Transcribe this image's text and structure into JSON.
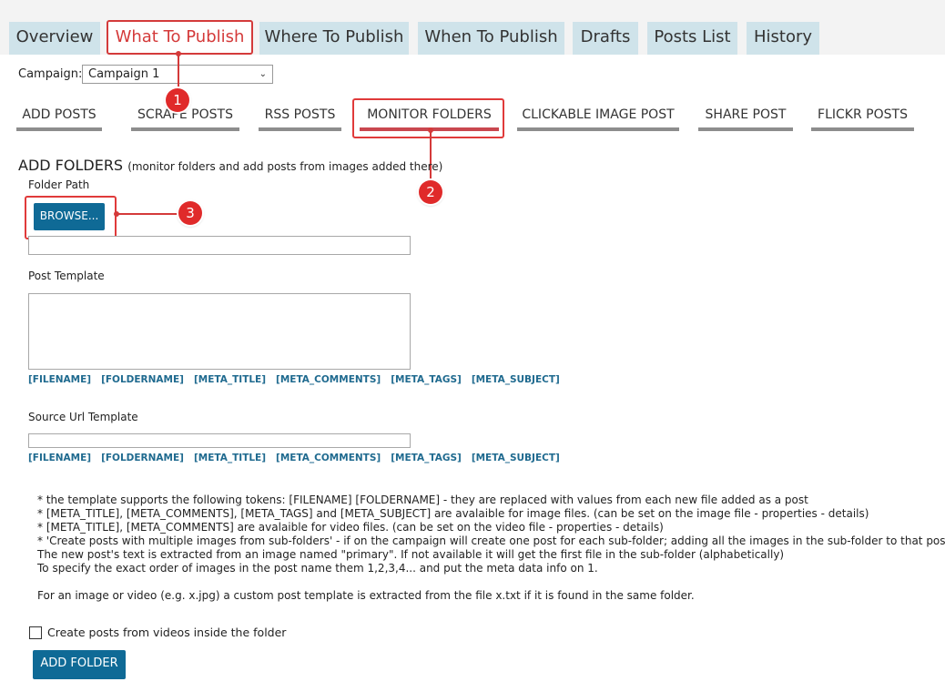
{
  "tabs": [
    {
      "label": "Overview"
    },
    {
      "label": "What To Publish"
    },
    {
      "label": "Where To Publish"
    },
    {
      "label": "When To Publish"
    },
    {
      "label": "Drafts"
    },
    {
      "label": "Posts List"
    },
    {
      "label": "History"
    }
  ],
  "campaign": {
    "label": "Campaign:",
    "value": "Campaign 1"
  },
  "subtabs": [
    {
      "label": "ADD POSTS"
    },
    {
      "label": "SCRAPE POSTS"
    },
    {
      "label": "RSS POSTS"
    },
    {
      "label": "MONITOR FOLDERS"
    },
    {
      "label": "CLICKABLE IMAGE POST"
    },
    {
      "label": "SHARE POST"
    },
    {
      "label": "FLICKR POSTS"
    }
  ],
  "section": {
    "title": "ADD FOLDERS",
    "subtitle": "(monitor folders and add posts from images added there)"
  },
  "folder_path": {
    "label": "Folder Path",
    "browse_label": "BROWSE...",
    "value": ""
  },
  "post_template": {
    "label": "Post Template",
    "value": ""
  },
  "source_url": {
    "label": "Source Url Template",
    "value": ""
  },
  "tokens": [
    "[FILENAME]",
    "[FOLDERNAME]",
    "[META_TITLE]",
    "[META_COMMENTS]",
    "[META_TAGS]",
    "[META_SUBJECT]"
  ],
  "notes": [
    "* the template supports the following tokens:  [FILENAME]  [FOLDERNAME]  - they are replaced with values from each new file added as a post",
    "* [META_TITLE], [META_COMMENTS], [META_TAGS] and [META_SUBJECT] are avalaible for image files. (can be set on the image file - properties - details)",
    "* [META_TITLE], [META_COMMENTS] are avalaible for video files. (can be set on the video file - properties - details)",
    "* 'Create posts with multiple images from sub-folders' - if on the campaign will create one post for each sub-folder; adding all the images in the sub-folder to that post.",
    "The new post's text is extracted from an image named \"primary\". If not available it will get the first file in the sub-folder (alphabetically)",
    "To specify the exact order of images in the post name them 1,2,3,4...  and put the meta data info on 1.",
    "",
    "For an image or video (e.g. x.jpg) a custom post template is extracted from the file x.txt if it is found in the same folder."
  ],
  "videos_checkbox": {
    "label": "Create posts from videos inside the folder",
    "checked": false
  },
  "add_folder_label": "ADD FOLDER",
  "callouts": [
    "1",
    "2",
    "3"
  ]
}
